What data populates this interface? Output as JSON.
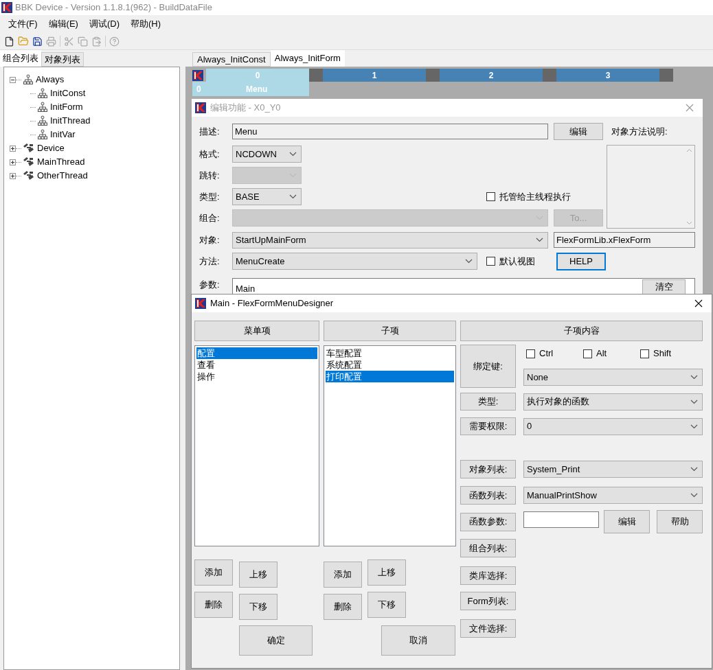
{
  "window": {
    "title": "BBK Device - Version 1.1.8.1(962) - BuildDataFile"
  },
  "menu": [
    "文件(F)",
    "编辑(E)",
    "调试(D)",
    "帮助(H)"
  ],
  "left_tabs": [
    {
      "label": "组合列表",
      "selected": true
    },
    {
      "label": "对象列表",
      "selected": false
    }
  ],
  "tree": [
    {
      "label": "Always",
      "kind": "group",
      "expanded": true,
      "children": [
        {
          "label": "InitConst",
          "kind": "group"
        },
        {
          "label": "InitForm",
          "kind": "group"
        },
        {
          "label": "InitThread",
          "kind": "group"
        },
        {
          "label": "InitVar",
          "kind": "group"
        }
      ]
    },
    {
      "label": "Device",
      "kind": "thread",
      "expanded": false
    },
    {
      "label": "MainThread",
      "kind": "thread",
      "expanded": false
    },
    {
      "label": "OtherThread",
      "kind": "thread",
      "expanded": false
    }
  ],
  "doc_tabs": [
    {
      "label": "Always_InitConst",
      "selected": false
    },
    {
      "label": "Always_InitForm",
      "selected": true
    }
  ],
  "grid": {
    "columns": [
      {
        "label": "0",
        "selected": true
      },
      {
        "label": "1",
        "selected": false
      },
      {
        "label": "2",
        "selected": false
      },
      {
        "label": "3",
        "selected": false
      }
    ],
    "row": {
      "label": "0",
      "text": "Menu"
    }
  },
  "edit_dialog": {
    "title": "编辑功能 - X0_Y0",
    "description": {
      "label": "描述:",
      "value": "Menu"
    },
    "edit_button": "编辑",
    "notes_label": "对象方法说明:",
    "format": {
      "label": "格式:",
      "value": "NCDOWN",
      "disabled": false
    },
    "jump": {
      "label": "跳转:",
      "disabled": true
    },
    "type": {
      "label": "类型:",
      "value": "BASE",
      "disabled": false
    },
    "main_thread": {
      "label": "托管给主线程执行",
      "checked": false
    },
    "group": {
      "label": "组合:",
      "disabled": true
    },
    "to_button": {
      "label": "To...",
      "disabled": true
    },
    "object": {
      "label": "对象:",
      "value": "StartUpMainForm",
      "disabled": false
    },
    "object_class": "FlexFormLib.xFlexForm",
    "method": {
      "label": "方法:",
      "value": "MenuCreate",
      "disabled": false
    },
    "default_view": {
      "label": "默认视图",
      "checked": false
    },
    "help_button": "HELP",
    "params": {
      "label": "参数:",
      "value": "Main"
    },
    "clear_button": "清空"
  },
  "designer": {
    "title": "Main - FlexFormMenuDesigner",
    "headers": [
      "菜单项",
      "子项",
      "子项内容"
    ],
    "menu_items": [
      {
        "label": "配置",
        "selected": true
      },
      {
        "label": "查看",
        "selected": false
      },
      {
        "label": "操作",
        "selected": false
      }
    ],
    "sub_items": [
      {
        "label": "车型配置",
        "selected": false
      },
      {
        "label": "系统配置",
        "selected": false
      },
      {
        "label": "打印配置",
        "selected": true
      }
    ],
    "menu_buttons": [
      "添加",
      "上移",
      "删除",
      "下移"
    ],
    "sub_buttons": [
      "添加",
      "上移",
      "删除",
      "下移"
    ],
    "ok": "确定",
    "cancel": "取消",
    "hotkey": {
      "label": "绑定键:",
      "modifiers": [
        {
          "label": "Ctrl",
          "checked": false
        },
        {
          "label": "Alt",
          "checked": false
        },
        {
          "label": "Shift",
          "checked": false
        }
      ],
      "key": "None"
    },
    "settings": [
      {
        "label": "类型:",
        "value": "执行对象的函数"
      },
      {
        "label": "需要权限:",
        "value": "0"
      }
    ],
    "lists": [
      {
        "label": "对象列表:",
        "value": "System_Print"
      },
      {
        "label": "函数列表:",
        "value": "ManualPrintShow"
      }
    ],
    "function_params": {
      "label": "函数参数:",
      "edit": "编辑",
      "help": "帮助"
    },
    "pickers": [
      "组合列表:",
      "类库选择:",
      "Form列表:",
      "文件选择:"
    ]
  }
}
